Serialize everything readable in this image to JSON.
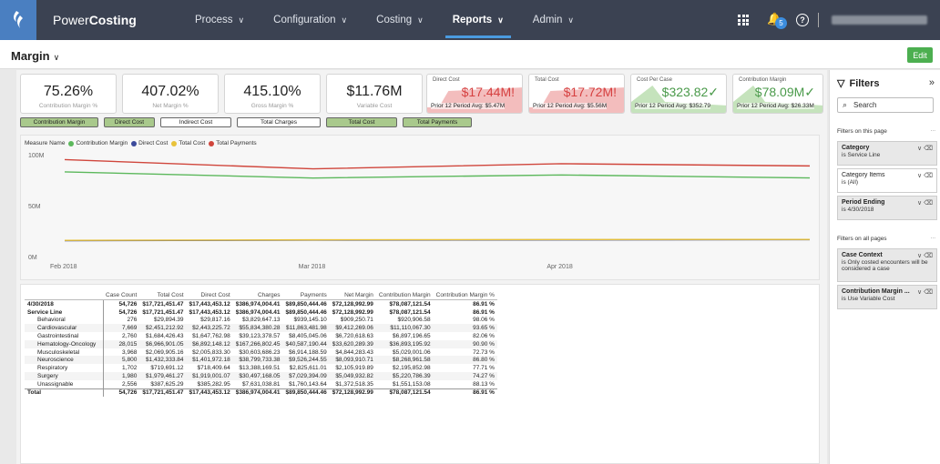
{
  "app": {
    "brand_light": "Power",
    "brand_bold": "Costing"
  },
  "nav": [
    {
      "label": "Process"
    },
    {
      "label": "Configuration"
    },
    {
      "label": "Costing"
    },
    {
      "label": "Reports"
    },
    {
      "label": "Admin"
    }
  ],
  "notifications": {
    "count": "5"
  },
  "page": {
    "title": "Margin",
    "edit_label": "Edit"
  },
  "kpis": [
    {
      "value": "75.26%",
      "label": "Contribution Margin %"
    },
    {
      "value": "407.02%",
      "label": "Net Margin %"
    },
    {
      "value": "415.10%",
      "label": "Gross Margin %"
    },
    {
      "value": "$11.76M",
      "label": "Variable Cost"
    }
  ],
  "trend_kpis": [
    {
      "title": "Direct Cost",
      "value": "$17.44M",
      "indicator": "!",
      "prior": "Prior 12 Period Avg: $5.47M",
      "color": "#d64040",
      "fill": "#f2b6b6"
    },
    {
      "title": "Total Cost",
      "value": "$17.72M",
      "indicator": "!",
      "prior": "Prior 12 Period Avg: $5.56M",
      "color": "#d64040",
      "fill": "#f2b6b6"
    },
    {
      "title": "Cost Per Case",
      "value": "$323.82",
      "indicator": "✓",
      "prior": "Prior 12 Period Avg: $352.79",
      "color": "#4a9a4a",
      "fill": "#bfe0b5"
    },
    {
      "title": "Contribution Margin",
      "value": "$78.09M",
      "indicator": "✓",
      "prior": "Prior 12 Period Avg: $26.33M",
      "color": "#4a9a4a",
      "fill": "#bfe0b5"
    }
  ],
  "measure_buttons": [
    {
      "label": "Contribution Margin",
      "selected": true
    },
    {
      "label": "Direct Cost",
      "selected": true
    },
    {
      "label": "Indirect Cost",
      "selected": false
    },
    {
      "label": "Total Charges",
      "selected": false
    },
    {
      "label": "Total Cost",
      "selected": true
    },
    {
      "label": "Total Payments",
      "selected": true
    }
  ],
  "chart_data": {
    "type": "line",
    "legend_title": "Measure Name",
    "x": [
      "Feb 2018",
      "Mar 2018",
      "Apr 2018",
      "Apr 30 2018"
    ],
    "x_tick_labels": [
      "Feb 2018",
      "Mar 2018",
      "Apr 2018"
    ],
    "ylim": [
      0,
      100000000
    ],
    "y_tick_labels": [
      "100M",
      "50M",
      "0M"
    ],
    "y_ticks": [
      100000000,
      50000000,
      0
    ],
    "series": [
      {
        "name": "Contribution Margin",
        "color": "#5cb85c",
        "values": [
          84000000,
          78000000,
          81000000,
          78090000
        ]
      },
      {
        "name": "Direct Cost",
        "color": "#3b4a9b",
        "values": [
          16500000,
          17000000,
          17300000,
          17440000
        ]
      },
      {
        "name": "Total Cost",
        "color": "#e8c23a",
        "values": [
          16800000,
          17300000,
          17600000,
          17720000
        ]
      },
      {
        "name": "Total Payments",
        "color": "#d0463c",
        "values": [
          96000000,
          87000000,
          92000000,
          89850000
        ]
      }
    ],
    "legend_position": "top-left",
    "grid": false
  },
  "table": {
    "columns": [
      "",
      "Case Count",
      "Total Cost",
      "Direct Cost",
      "Charges",
      "Payments",
      "Net Margin",
      "Contribution Margin",
      "Contribution Margin %"
    ],
    "rows": [
      {
        "kind": "bold",
        "cells": [
          "4/30/2018",
          "54,726",
          "$17,721,451.47",
          "$17,443,453.12",
          "$386,974,004.41",
          "$89,850,444.46",
          "$72,128,992.99",
          "$78,087,121.54",
          "86.91 %"
        ]
      },
      {
        "kind": "bold",
        "cells": [
          "Service Line",
          "54,726",
          "$17,721,451.47",
          "$17,443,453.12",
          "$386,974,004.41",
          "$89,850,444.46",
          "$72,128,992.99",
          "$78,087,121.54",
          "86.91 %"
        ]
      },
      {
        "kind": "child",
        "cells": [
          "Behavioral",
          "276",
          "$29,894.39",
          "$29,817.16",
          "$3,829,647.13",
          "$939,145.10",
          "$909,250.71",
          "$920,906.58",
          "98.06 %"
        ]
      },
      {
        "kind": "child",
        "cells": [
          "Cardiovascular",
          "7,669",
          "$2,451,212.92",
          "$2,443,225.72",
          "$55,834,380.28",
          "$11,863,481.98",
          "$9,412,269.06",
          "$11,110,067.30",
          "93.65 %"
        ]
      },
      {
        "kind": "child",
        "cells": [
          "Gastrointestinal",
          "2,760",
          "$1,684,426.43",
          "$1,647,762.98",
          "$39,123,378.57",
          "$8,405,045.06",
          "$6,720,618.63",
          "$6,897,196.65",
          "82.06 %"
        ]
      },
      {
        "kind": "child",
        "cells": [
          "Hematology-Oncology",
          "28,015",
          "$6,966,901.05",
          "$6,892,148.12",
          "$167,266,802.45",
          "$40,587,190.44",
          "$33,620,289.39",
          "$36,893,195.92",
          "90.90 %"
        ]
      },
      {
        "kind": "child",
        "cells": [
          "Musculoskeletal",
          "3,968",
          "$2,069,905.16",
          "$2,005,833.30",
          "$30,603,686.23",
          "$6,914,188.59",
          "$4,844,283.43",
          "$5,029,001.06",
          "72.73 %"
        ]
      },
      {
        "kind": "child",
        "cells": [
          "Neuroscience",
          "5,800",
          "$1,432,333.84",
          "$1,401,972.18",
          "$38,799,733.38",
          "$9,526,244.55",
          "$8,093,910.71",
          "$8,268,961.58",
          "86.80 %"
        ]
      },
      {
        "kind": "child",
        "cells": [
          "Respiratory",
          "1,702",
          "$719,691.12",
          "$718,409.64",
          "$13,388,169.51",
          "$2,825,611.01",
          "$2,105,919.89",
          "$2,195,852.98",
          "77.71 %"
        ]
      },
      {
        "kind": "child",
        "cells": [
          "Surgery",
          "1,980",
          "$1,979,461.27",
          "$1,919,001.07",
          "$30,497,168.05",
          "$7,029,394.09",
          "$5,049,932.82",
          "$5,220,786.39",
          "74.27 %"
        ]
      },
      {
        "kind": "child",
        "cells": [
          "Unassignable",
          "2,556",
          "$387,625.29",
          "$385,282.95",
          "$7,631,038.81",
          "$1,760,143.64",
          "$1,372,518.35",
          "$1,551,153.08",
          "88.13 %"
        ]
      },
      {
        "kind": "total",
        "cells": [
          "Total",
          "54,726",
          "$17,721,451.47",
          "$17,443,453.12",
          "$386,974,004.41",
          "$89,850,444.46",
          "$72,128,992.99",
          "$78,087,121.54",
          "86.91 %"
        ]
      }
    ]
  },
  "filters": {
    "title": "Filters",
    "search_placeholder": "Search",
    "section_page": "Filters on this page",
    "section_all": "Filters on all pages",
    "page_filters": [
      {
        "name": "Category",
        "cond": "is Service Line",
        "shaded": true,
        "bold": true
      },
      {
        "name": "Category Items",
        "cond": "is (All)",
        "shaded": false,
        "bold": false
      },
      {
        "name": "Period Ending",
        "cond": "is 4/30/2018",
        "shaded": true,
        "bold": true
      }
    ],
    "all_filters": [
      {
        "name": "Case Context",
        "cond": "is Only costed encounters will be considered a case"
      },
      {
        "name": "Contribution Margin ...",
        "cond": "is Use Variable Cost"
      }
    ]
  }
}
